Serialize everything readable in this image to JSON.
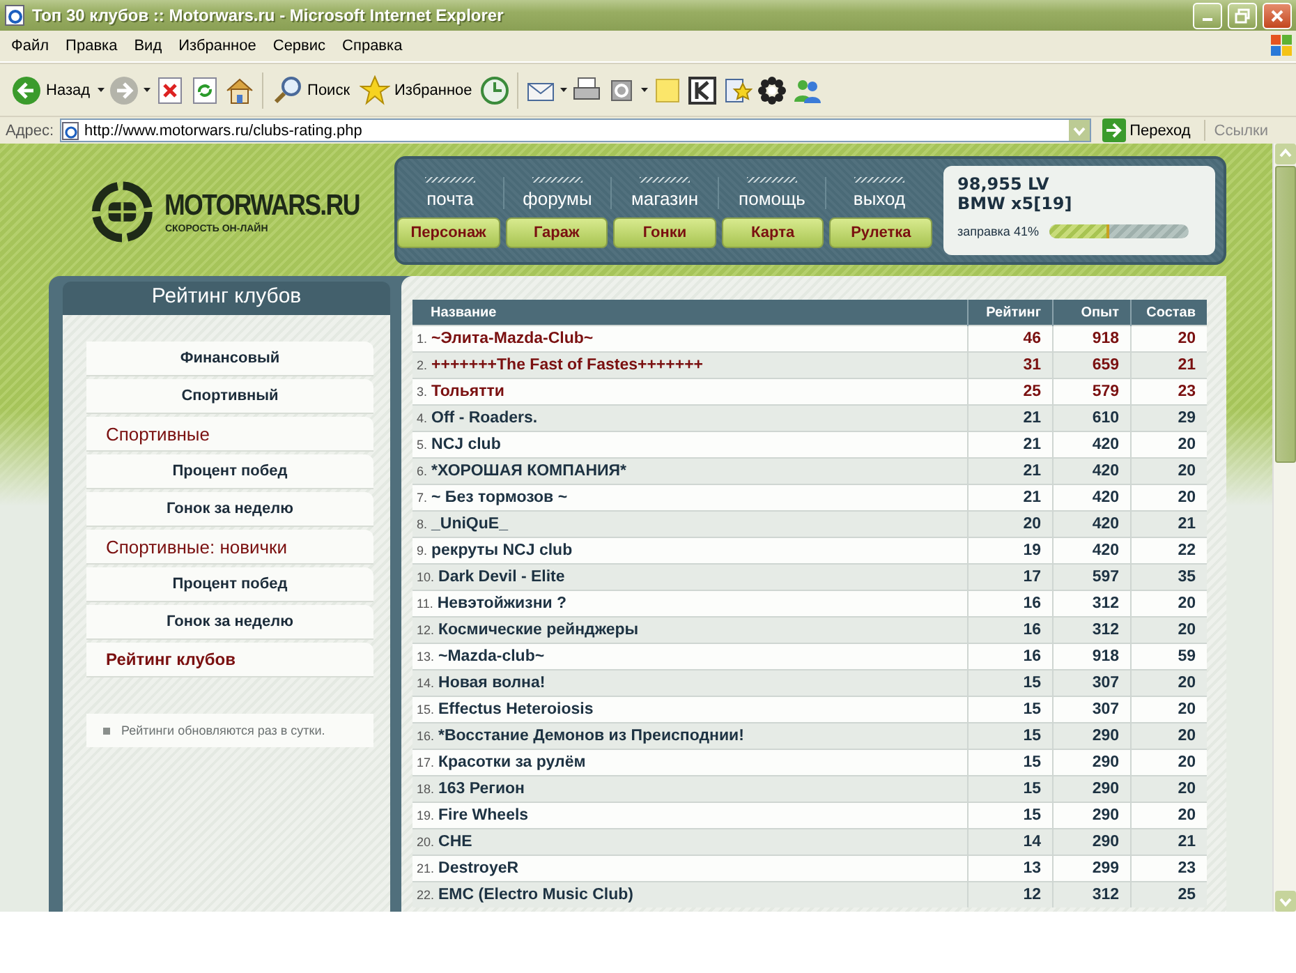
{
  "window": {
    "title": "Топ 30 клубов :: Motorwars.ru - Microsoft Internet Explorer"
  },
  "menu": [
    "Файл",
    "Правка",
    "Вид",
    "Избранное",
    "Сервис",
    "Справка"
  ],
  "toolbar": {
    "back_label": "Назад",
    "search_label": "Поиск",
    "favorites_label": "Избранное"
  },
  "address_bar": {
    "label": "Адрес:",
    "url": "http://www.motorwars.ru/clubs-rating.php",
    "go_label": "Переход",
    "links_label": "Ссылки"
  },
  "logo": {
    "name": "MOTORWARS.RU",
    "tagline": "СКОРОСТЬ ОН-ЛАЙН"
  },
  "nav_links": [
    "почта",
    "форумы",
    "магазин",
    "помощь",
    "выход"
  ],
  "nav_buttons": [
    "Персонаж",
    "Гараж",
    "Гонки",
    "Карта",
    "Рулетка"
  ],
  "player": {
    "money": "98,955 LV",
    "car": "BMW x5[19]",
    "fuel_label": "заправка 41%",
    "level": 0.41
  },
  "sidebar": {
    "title": "Рейтинг клубов",
    "items": [
      {
        "label": "Финансовый",
        "kind": "item"
      },
      {
        "label": "Спортивный",
        "kind": "item"
      },
      {
        "label": "Спортивные",
        "kind": "group"
      },
      {
        "label": "Процент побед",
        "kind": "item"
      },
      {
        "label": "Гонок за неделю",
        "kind": "item"
      },
      {
        "label": "Спортивные: новички",
        "kind": "group"
      },
      {
        "label": "Процент побед",
        "kind": "item"
      },
      {
        "label": "Гонок за неделю",
        "kind": "item"
      },
      {
        "label": "Рейтинг клубов",
        "kind": "current"
      }
    ],
    "note": "Рейтинги обновляются раз в сутки."
  },
  "table": {
    "columns": [
      "Название",
      "Рейтинг",
      "Опыт",
      "Состав"
    ],
    "rows": [
      {
        "rank": "1.",
        "name": "~Элита-Mazda-Club~",
        "rating": "46",
        "experience": "918",
        "members": "20",
        "highlighted": true
      },
      {
        "rank": "2.",
        "name": "+++++++The Fast of Fastes+++++++",
        "rating": "31",
        "experience": "659",
        "members": "21",
        "highlighted": true
      },
      {
        "rank": "3.",
        "name": "Тольятти",
        "rating": "25",
        "experience": "579",
        "members": "23",
        "highlighted": true
      },
      {
        "rank": "4.",
        "name": "Off - Roaders.",
        "rating": "21",
        "experience": "610",
        "members": "29",
        "highlighted": false
      },
      {
        "rank": "5.",
        "name": "NCJ club",
        "rating": "21",
        "experience": "420",
        "members": "20",
        "highlighted": false
      },
      {
        "rank": "6.",
        "name": "*ХОРОШАЯ КОМПАНИЯ*",
        "rating": "21",
        "experience": "420",
        "members": "20",
        "highlighted": false
      },
      {
        "rank": "7.",
        "name": "~ Без тормозов ~",
        "rating": "21",
        "experience": "420",
        "members": "20",
        "highlighted": false
      },
      {
        "rank": "8.",
        "name": "_UniQuE_",
        "rating": "20",
        "experience": "420",
        "members": "21",
        "highlighted": false
      },
      {
        "rank": "9.",
        "name": "рекруты NCJ club",
        "rating": "19",
        "experience": "420",
        "members": "22",
        "highlighted": false
      },
      {
        "rank": "10.",
        "name": "Dark Devil - Elite",
        "rating": "17",
        "experience": "597",
        "members": "35",
        "highlighted": false
      },
      {
        "rank": "11.",
        "name": "Невэтойжизни ?",
        "rating": "16",
        "experience": "312",
        "members": "20",
        "highlighted": false
      },
      {
        "rank": "12.",
        "name": "Космические рейнджеры",
        "rating": "16",
        "experience": "312",
        "members": "20",
        "highlighted": false
      },
      {
        "rank": "13.",
        "name": "~Mazda-club~",
        "rating": "16",
        "experience": "918",
        "members": "59",
        "highlighted": false
      },
      {
        "rank": "14.",
        "name": "Новая волна!",
        "rating": "15",
        "experience": "307",
        "members": "20",
        "highlighted": false
      },
      {
        "rank": "15.",
        "name": "Effectus Heteroiosis",
        "rating": "15",
        "experience": "307",
        "members": "20",
        "highlighted": false
      },
      {
        "rank": "16.",
        "name": "*Восстание Демонов из Преисподнии!",
        "rating": "15",
        "experience": "290",
        "members": "20",
        "highlighted": false
      },
      {
        "rank": "17.",
        "name": "Красотки за рулём",
        "rating": "15",
        "experience": "290",
        "members": "20",
        "highlighted": false
      },
      {
        "rank": "18.",
        "name": "163 Регион",
        "rating": "15",
        "experience": "290",
        "members": "20",
        "highlighted": false
      },
      {
        "rank": "19.",
        "name": "Fire Wheels",
        "rating": "15",
        "experience": "290",
        "members": "20",
        "highlighted": false
      },
      {
        "rank": "20.",
        "name": "CHE",
        "rating": "14",
        "experience": "290",
        "members": "21",
        "highlighted": false
      },
      {
        "rank": "21.",
        "name": "DestroyeR",
        "rating": "13",
        "experience": "299",
        "members": "23",
        "highlighted": false
      },
      {
        "rank": "22.",
        "name": "EMC (Electro Music Club)",
        "rating": "12",
        "experience": "312",
        "members": "25",
        "highlighted": false
      }
    ]
  }
}
